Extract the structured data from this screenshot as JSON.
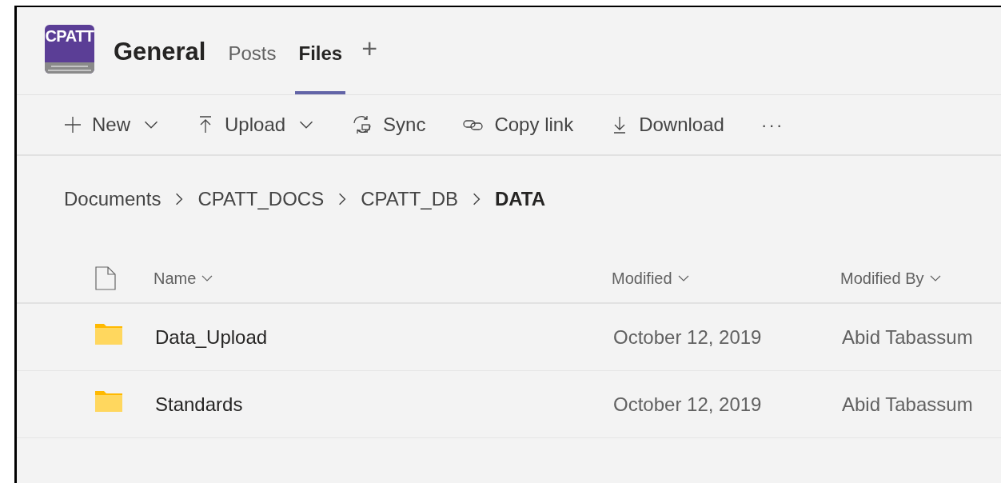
{
  "team": {
    "logo_text": "CPATT",
    "channel": "General"
  },
  "tabs": [
    {
      "label": "Posts",
      "selected": false
    },
    {
      "label": "Files",
      "selected": true
    }
  ],
  "add_tab": "+",
  "toolbar": [
    {
      "kind": "new",
      "label": "New",
      "dropdown": true
    },
    {
      "kind": "upload",
      "label": "Upload",
      "dropdown": true
    },
    {
      "kind": "sync",
      "label": "Sync",
      "dropdown": false
    },
    {
      "kind": "link",
      "label": "Copy link",
      "dropdown": false
    },
    {
      "kind": "download",
      "label": "Download",
      "dropdown": false
    }
  ],
  "more": "···",
  "breadcrumb": [
    {
      "label": "Documents",
      "current": false
    },
    {
      "label": "CPATT_DOCS",
      "current": false
    },
    {
      "label": "CPATT_DB",
      "current": false
    },
    {
      "label": "DATA",
      "current": true
    }
  ],
  "table": {
    "columns": [
      "Name",
      "Modified",
      "Modified By"
    ],
    "rows": [
      {
        "name": "Data_Upload",
        "modified": "October 12, 2019",
        "modified_by": "Abid Tabassum"
      },
      {
        "name": "Standards",
        "modified": "October 12, 2019",
        "modified_by": "Abid Tabassum"
      }
    ]
  }
}
